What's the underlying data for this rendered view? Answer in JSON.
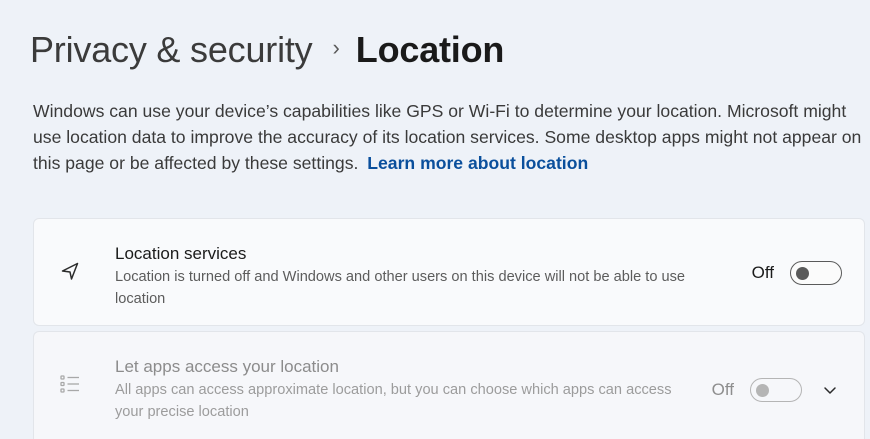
{
  "breadcrumb": {
    "parent": "Privacy & security",
    "separator": "›",
    "current": "Location"
  },
  "description": {
    "text": "Windows can use your device’s capabilities like GPS or Wi-Fi to determine your location. Microsoft might use location data to improve the accuracy of its location services. Some desktop apps might not appear on this page or be affected by these settings.",
    "link_text": "Learn more about location"
  },
  "settings": [
    {
      "icon": "location-arrow-icon",
      "title": "Location services",
      "subtitle": "Location is turned off and Windows and other users on this device will not be able to use location",
      "toggle_label": "Off",
      "toggle_on": false,
      "enabled": true
    },
    {
      "icon": "list-icon",
      "title": "Let apps access your location",
      "subtitle": "All apps can access approximate location, but you can choose which apps can access your precise location",
      "toggle_label": "Off",
      "toggle_on": false,
      "enabled": false,
      "expandable": true
    }
  ],
  "colors": {
    "background": "#eef2f8",
    "link": "#0a4f9c",
    "card": "#f9fafc",
    "toggle_off": "#5a5a5a",
    "disabled": "#b5b5b5"
  }
}
